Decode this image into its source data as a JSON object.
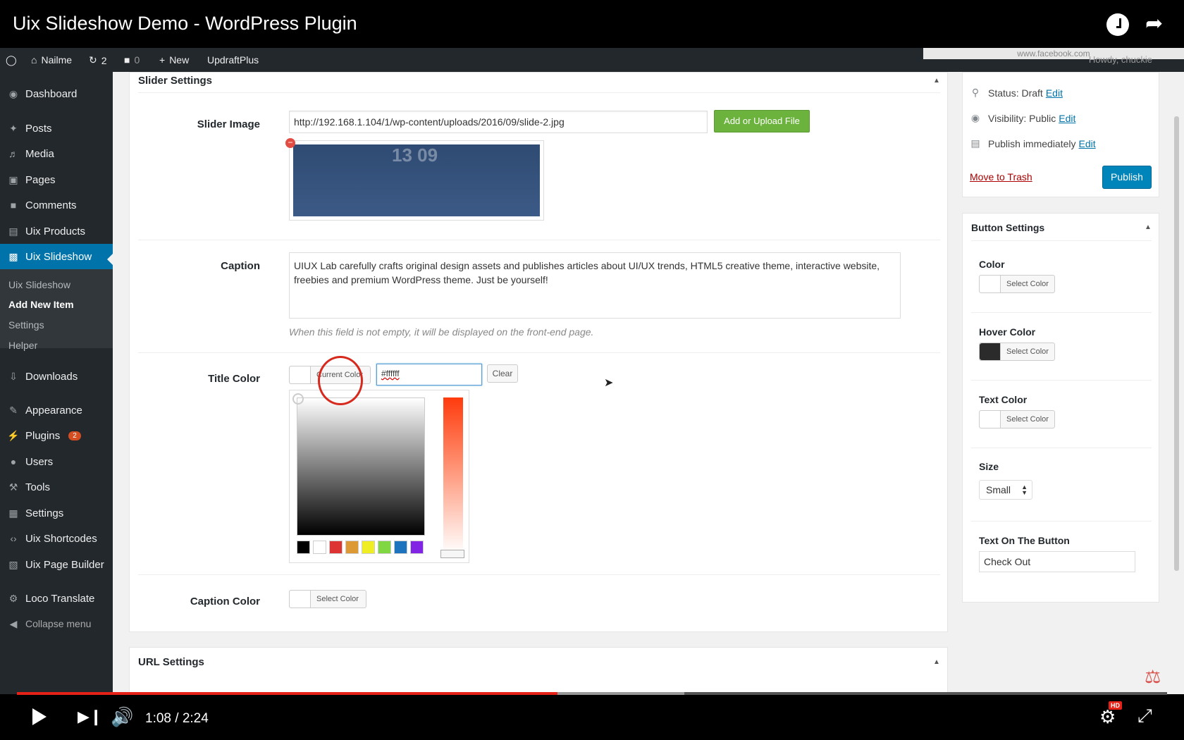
{
  "video": {
    "title": "Uix Slideshow Demo - WordPress Plugin",
    "time_current": "1:08",
    "time_total": "2:24",
    "time_display": "1:08 / 2:24",
    "progress_played_fraction": 0.47,
    "progress_buffered_fraction": 0.58,
    "hd_label": "HD"
  },
  "adminbar": {
    "site_name": "Nailme",
    "updates_count": "2",
    "comments_count": "0",
    "new_label": "New",
    "plugin_label": "UpdraftPlus",
    "tooltip_url": "www.facebook.com",
    "howdy": "Howdy, chuckie"
  },
  "sidebar": {
    "items": [
      {
        "label": "Dashboard",
        "icon": "dashboard-icon"
      },
      {
        "label": "Posts",
        "icon": "pin-icon"
      },
      {
        "label": "Media",
        "icon": "media-icon"
      },
      {
        "label": "Pages",
        "icon": "pages-icon"
      },
      {
        "label": "Comments",
        "icon": "comment-icon"
      },
      {
        "label": "Uix Products",
        "icon": "products-icon"
      },
      {
        "label": "Uix Slideshow",
        "icon": "slideshow-icon"
      },
      {
        "label": "Downloads",
        "icon": "download-icon"
      },
      {
        "label": "Appearance",
        "icon": "brush-icon"
      },
      {
        "label": "Plugins",
        "icon": "plugin-icon",
        "badge": "2"
      },
      {
        "label": "Users",
        "icon": "user-icon"
      },
      {
        "label": "Tools",
        "icon": "wrench-icon"
      },
      {
        "label": "Settings",
        "icon": "settings-icon"
      },
      {
        "label": "Uix Shortcodes",
        "icon": "code-icon"
      },
      {
        "label": "Uix Page Builder",
        "icon": "builder-icon"
      },
      {
        "label": "Loco Translate",
        "icon": "translate-icon"
      },
      {
        "label": "Collapse menu",
        "icon": "collapse-icon"
      }
    ],
    "submenu": [
      "Uix Slideshow",
      "Add New Item",
      "Settings",
      "Helper"
    ]
  },
  "slider_settings": {
    "title": "Slider Settings",
    "slider_image_label": "Slider Image",
    "slider_image_url": "http://192.168.1.104/1/wp-content/uploads/2016/09/slide-2.jpg",
    "upload_button": "Add or Upload File",
    "thumb_text": "13 09",
    "caption_label": "Caption",
    "caption_text": "UIUX Lab carefully crafts original design assets and publishes articles about UI/UX trends, HTML5 creative theme, interactive website, freebies and premium WordPress theme. Just be yourself!",
    "caption_hint": "When this field is not empty, it will be displayed on the front-end page.",
    "title_color_label": "Title Color",
    "current_color_label": "Current Color",
    "hex_value": "#ffffff",
    "clear_label": "Clear",
    "palette": [
      "#000000",
      "#ffffff",
      "#dd3333",
      "#dd9933",
      "#eeee22",
      "#81d742",
      "#1e73be",
      "#8224e3"
    ],
    "caption_color_label": "Caption Color",
    "select_color": "Select Color"
  },
  "url_settings": {
    "title": "URL Settings"
  },
  "publish": {
    "status_label": "Status:",
    "status_value": "Draft",
    "visibility_label": "Visibility:",
    "visibility_value": "Public",
    "publish_label": "Publish",
    "publish_when": "immediately",
    "edit_label": "Edit",
    "trash_label": "Move to Trash",
    "publish_button": "Publish"
  },
  "button_settings": {
    "title": "Button Settings",
    "color_label": "Color",
    "hover_color_label": "Hover Color",
    "text_color_label": "Text Color",
    "select_color": "Select Color",
    "size_label": "Size",
    "size_value": "Small",
    "text_on_button_label": "Text On The Button",
    "text_on_button_value": "Check Out"
  },
  "colors": {
    "wp_dark": "#23282d",
    "wp_blue": "#0073aa",
    "green_button": "#6cb33e",
    "yt_red": "#e62117",
    "hover_swatch": "#2b2b2b"
  }
}
